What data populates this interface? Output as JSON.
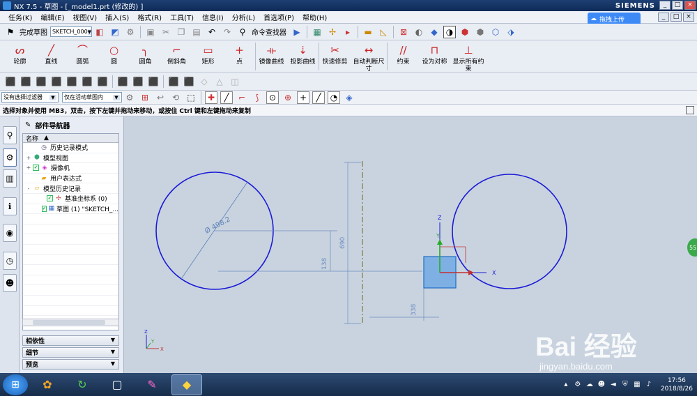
{
  "window": {
    "title": "NX 7.5 - 草图 - [_model1.prt (修改的) ]",
    "brand": "SIEMENS",
    "controls": [
      "_",
      "□",
      "×"
    ]
  },
  "menubar": {
    "items": [
      "任务(K)",
      "编辑(E)",
      "视图(V)",
      "插入(S)",
      "格式(R)",
      "工具(T)",
      "信息(I)",
      "分析(L)",
      "首选项(P)",
      "帮助(H)"
    ],
    "upload_label": "拖拽上传"
  },
  "toolbar1": {
    "finish_sketch": "完成草图",
    "sketch_name": "SKETCH_000",
    "command_finder": "命令查找器"
  },
  "sketch_tools": [
    {
      "label": "轮廓",
      "icon": "profile-icon",
      "glyph": "ᔕ"
    },
    {
      "label": "直线",
      "icon": "line-icon",
      "glyph": "╱"
    },
    {
      "label": "圆弧",
      "icon": "arc-icon",
      "glyph": "⌒"
    },
    {
      "label": "圆",
      "icon": "circle-icon",
      "glyph": "○"
    },
    {
      "label": "圆角",
      "icon": "fillet-icon",
      "glyph": "╮"
    },
    {
      "label": "倒斜角",
      "icon": "chamfer-icon",
      "glyph": "⌐"
    },
    {
      "label": "矩形",
      "icon": "rectangle-icon",
      "glyph": "▭"
    },
    {
      "label": "点",
      "icon": "point-icon",
      "glyph": "+"
    },
    {
      "label": "镜像曲线",
      "icon": "mirror-curve-icon",
      "glyph": "⟛"
    },
    {
      "label": "投影曲线",
      "icon": "project-curve-icon",
      "glyph": "⇣"
    },
    {
      "label": "快速修剪",
      "icon": "quick-trim-icon",
      "glyph": "✂"
    },
    {
      "label": "自动判断尺寸",
      "icon": "dimension-icon",
      "glyph": "↔"
    },
    {
      "label": "约束",
      "icon": "constraint-icon",
      "glyph": "//"
    },
    {
      "label": "设为对称",
      "icon": "symmetric-icon",
      "glyph": "⊓"
    },
    {
      "label": "显示所有约束",
      "icon": "show-constraints-icon",
      "glyph": "⊥"
    }
  ],
  "selection_bar": {
    "filter": "没有选择过滤器",
    "scope": "仅在活动草图内"
  },
  "status": {
    "message": "选择对象并使用 MB3，双击，按下左键并拖动来移动，或按住 Ctrl 键和左键拖动来复制"
  },
  "navigator": {
    "title": "部件导航器",
    "column": "名称",
    "rows": [
      {
        "label": "历史记录模式",
        "indent": 1,
        "icon": "clock-icon",
        "expander": ""
      },
      {
        "label": "模型视图",
        "indent": 0,
        "icon": "model-views-icon",
        "expander": "+"
      },
      {
        "label": "摄像机",
        "indent": 0,
        "icon": "camera-icon",
        "expander": "+"
      },
      {
        "label": "用户表达式",
        "indent": 1,
        "icon": "folder-icon",
        "expander": ""
      },
      {
        "label": "模型历史记录",
        "indent": 0,
        "icon": "folder-open-icon",
        "expander": "-"
      },
      {
        "label": "基准坐标系 (0)",
        "indent": 2,
        "icon": "datum-csys-icon",
        "expander": ""
      },
      {
        "label": "草图 (1) \"SKETCH_...",
        "indent": 2,
        "icon": "sketch-icon",
        "expander": ""
      }
    ],
    "panels": [
      "相依性",
      "细节",
      "预览"
    ]
  },
  "drawing": {
    "dim_diameter": "Ø 498.2",
    "dim_vertical_left": "138",
    "dim_vertical_right": "690",
    "dim_bottom": "338",
    "axis_z": "Z",
    "axis_y": "Y",
    "axis_x": "X",
    "triad_z": "Z",
    "triad_y": "Y",
    "triad_x": "X"
  },
  "side_hint": "55",
  "watermark": {
    "main": "Bai 经验",
    "url": "jingyan.baidu.com"
  },
  "taskbar": {
    "time": "17:56",
    "date": "2018/8/26"
  }
}
